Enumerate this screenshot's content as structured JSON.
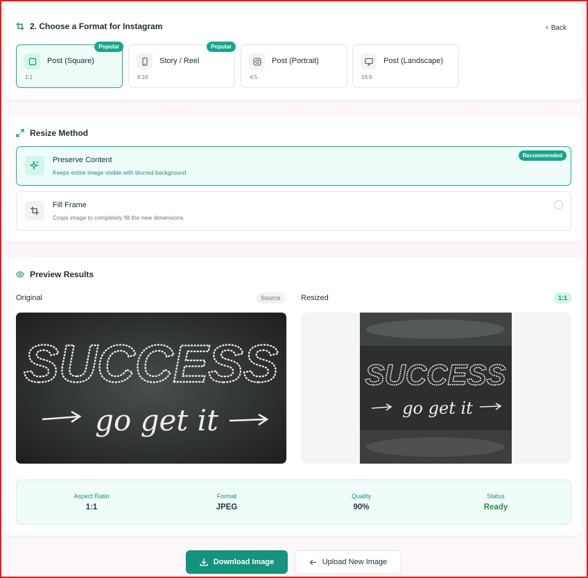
{
  "format_section": {
    "title": "2. Choose a Format for Instagram",
    "back_label": "Back",
    "formats": [
      {
        "label": "Post (Square)",
        "ratio": "1:1",
        "badge": "Popular",
        "icon": "square-icon"
      },
      {
        "label": "Story / Reel",
        "ratio": "9:16",
        "badge": "Popular",
        "icon": "phone-icon"
      },
      {
        "label": "Post (Portrait)",
        "ratio": "4:5",
        "badge": "",
        "icon": "instagram-icon"
      },
      {
        "label": "Post (Landscape)",
        "ratio": "16:9",
        "badge": "",
        "icon": "monitor-icon"
      }
    ]
  },
  "resize_section": {
    "title": "Resize Method",
    "methods": [
      {
        "title": "Preserve Content",
        "desc": "Keeps entire image visible with blurred background",
        "badge": "Recommended",
        "icon": "sparkle-icon"
      },
      {
        "title": "Fill Frame",
        "desc": "Crops image to completely fill the new dimensions",
        "badge": "",
        "icon": "crop-icon"
      }
    ]
  },
  "preview_section": {
    "title": "Preview Results",
    "original_label": "Original",
    "source_pill": "Source",
    "resized_label": "Resized",
    "ratio_pill": "1:1",
    "image_text": {
      "line1": "SUCCESS",
      "line2": "go get it"
    }
  },
  "stats": [
    {
      "key": "Aspect Ratio",
      "value": "1:1"
    },
    {
      "key": "Format",
      "value": "JPEG"
    },
    {
      "key": "Quality",
      "value": "90%"
    },
    {
      "key": "Status",
      "value": "Ready"
    }
  ],
  "actions": {
    "download_label": "Download Image",
    "upload_label": "Upload New Image"
  },
  "colors": {
    "accent": "#15937e",
    "accent_light": "#effdf9",
    "status_ok": "#2e8b4a"
  }
}
